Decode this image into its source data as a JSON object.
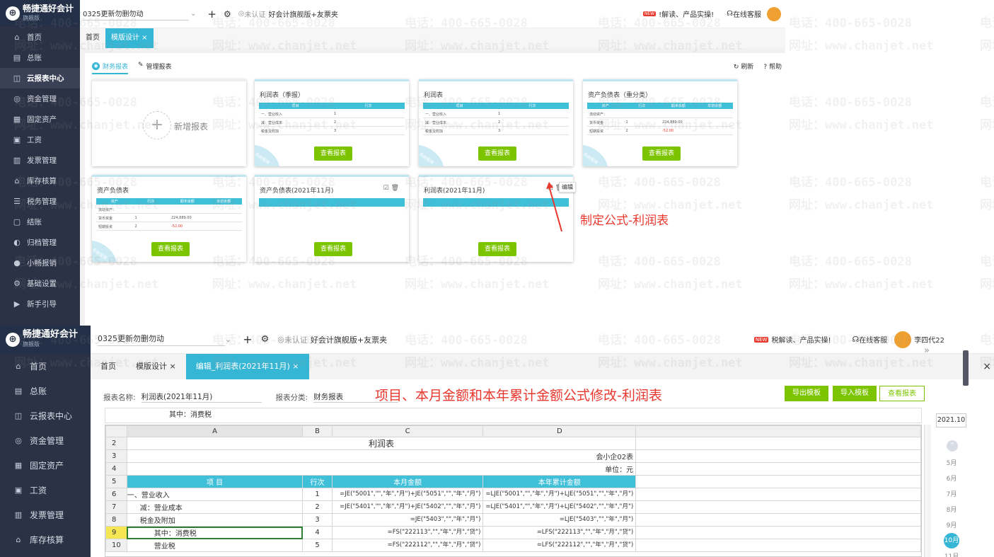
{
  "top_panel": {
    "logo": {
      "name": "畅捷通好会计",
      "sub": "旗舰版"
    },
    "company": "0325更新勿删勿动",
    "icons": [
      "plus-icon",
      "gear-icon"
    ],
    "cert": "未认证",
    "edition": "好会计旗舰版+友票夹",
    "promo": "!解读、产品实操!",
    "service": "在线客服",
    "sidebar": [
      "首页",
      "总账",
      "云报表中心",
      "资金管理",
      "固定资产",
      "工资",
      "发票管理",
      "库存核算",
      "税务管理",
      "结账",
      "归档管理",
      "小畅报销",
      "基础设置",
      "新手引导"
    ],
    "tabs": [
      "首页",
      "模版设计 ×"
    ],
    "subtabs": [
      "财务报表",
      "管理报表"
    ],
    "actions": [
      "刷新",
      "帮助"
    ],
    "add_report": "新增报表",
    "view_btn": "查看报表",
    "tooltip": "编辑",
    "ribbon": "系统报表",
    "cards": [
      {
        "title": "利润表（季报）",
        "cols": [
          "项目",
          "行次"
        ],
        "rows": [
          [
            "一、营业收入",
            "1"
          ],
          [
            "减：营业成本",
            "2"
          ],
          [
            "税金及附加",
            "3"
          ]
        ]
      },
      {
        "title": "利润表",
        "cols": [
          "项目",
          "行次"
        ],
        "rows": [
          [
            "一、营业收入",
            "1"
          ],
          [
            "减：营业成本",
            "2"
          ],
          [
            "税金及附加",
            "3"
          ]
        ]
      },
      {
        "title": "资产负债表（重分类）",
        "cols": [
          "资产",
          "行次",
          "期末余额",
          "年初余额"
        ],
        "rows": [
          [
            "流动资产：",
            "",
            ""
          ],
          [
            "货币资金",
            "1",
            "224,889.00"
          ],
          [
            "短期投资",
            "2",
            "-52.00"
          ]
        ]
      },
      {
        "title": "资产负债表",
        "cols": [
          "资产",
          "行次",
          "期末余额",
          "年初余额"
        ],
        "rows": [
          [
            "流动资产：",
            "",
            ""
          ],
          [
            "货币资金",
            "1",
            "224,889.00"
          ],
          [
            "短期投资",
            "2",
            "-52.00"
          ]
        ]
      },
      {
        "title": "资产负债表(2021年11月)"
      },
      {
        "title": "利润表(2021年11月)"
      }
    ],
    "annotation": "制定公式-利润表"
  },
  "bottom_panel": {
    "company": "0325更新勿删勿动",
    "cert": "未认证",
    "edition": "好会计旗舰版+友票夹",
    "promo": "税解读、产品实操!",
    "service": "在线客服",
    "user": "李四代22",
    "sidebar": [
      "首页",
      "总账",
      "云报表中心",
      "资金管理",
      "固定资产",
      "工资",
      "发票管理",
      "库存核算"
    ],
    "tabs": [
      "首页",
      "模版设计 ×",
      "编辑_利润表(2021年11月) ×"
    ],
    "form": {
      "name_label": "报表名称:",
      "name": "利润表(2021年11月)",
      "cat_label": "报表分类:",
      "cat": "财务报表"
    },
    "annotation": "项目、本月金额和本年累计金额公式修改-利润表",
    "buttons": [
      "导出模板",
      "导入模板",
      "查看报表"
    ],
    "formula_bar": "其中：消费税",
    "period": "2021.10",
    "months": [
      "5月",
      "6月",
      "7月",
      "8月",
      "9月",
      "10月",
      "11月"
    ],
    "sheet": {
      "cols": [
        "A",
        "B",
        "C",
        "D"
      ],
      "title": "利润表",
      "code": "会小企02表",
      "unit": "单位：元",
      "headers": [
        "项 目",
        "行次",
        "本月金额",
        "本年累计金额"
      ],
      "rows": [
        {
          "n": "6",
          "a": "一、营业收入",
          "b": "1",
          "c": "=JE(\"5001\",\"\",\"年\",\"月\")+JE(\"5051\",\"\",\"年\",\"月\")",
          "d": "=LJE(\"5001\",\"\",\"年\",\"月\")+LJE(\"5051\",\"\",\"年\",\"月\")"
        },
        {
          "n": "7",
          "a": "减：营业成本",
          "b": "2",
          "c": "=JE(\"5401\",\"\",\"年\",\"月\")+JE(\"5402\",\"\",\"年\",\"月\")",
          "d": "=LJE(\"5401\",\"\",\"年\",\"月\")+LJE(\"5402\",\"\",\"年\",\"月\")"
        },
        {
          "n": "8",
          "a": "税金及附加",
          "b": "3",
          "c": "=JE(\"5403\",\"\",\"年\",\"月\")",
          "d": "=LJE(\"5403\",\"\",\"年\",\"月\")"
        },
        {
          "n": "9",
          "a": "其中：消费税",
          "b": "4",
          "c": "=FS(\"222113\",\"\",\"年\",\"月\",\"贷\")",
          "d": "=LFS(\"222113\",\"\",\"年\",\"月\",\"贷\")"
        },
        {
          "n": "10",
          "a": "营业税",
          "b": "5",
          "c": "=FS(\"222112\",\"\",\"年\",\"月\",\"贷\")",
          "d": "=LFS(\"222112\",\"\",\"年\",\"月\",\"贷\")"
        }
      ]
    }
  },
  "watermark": {
    "phone": "电话：400-665-0028",
    "site": "网址：www.chanjet.net"
  }
}
